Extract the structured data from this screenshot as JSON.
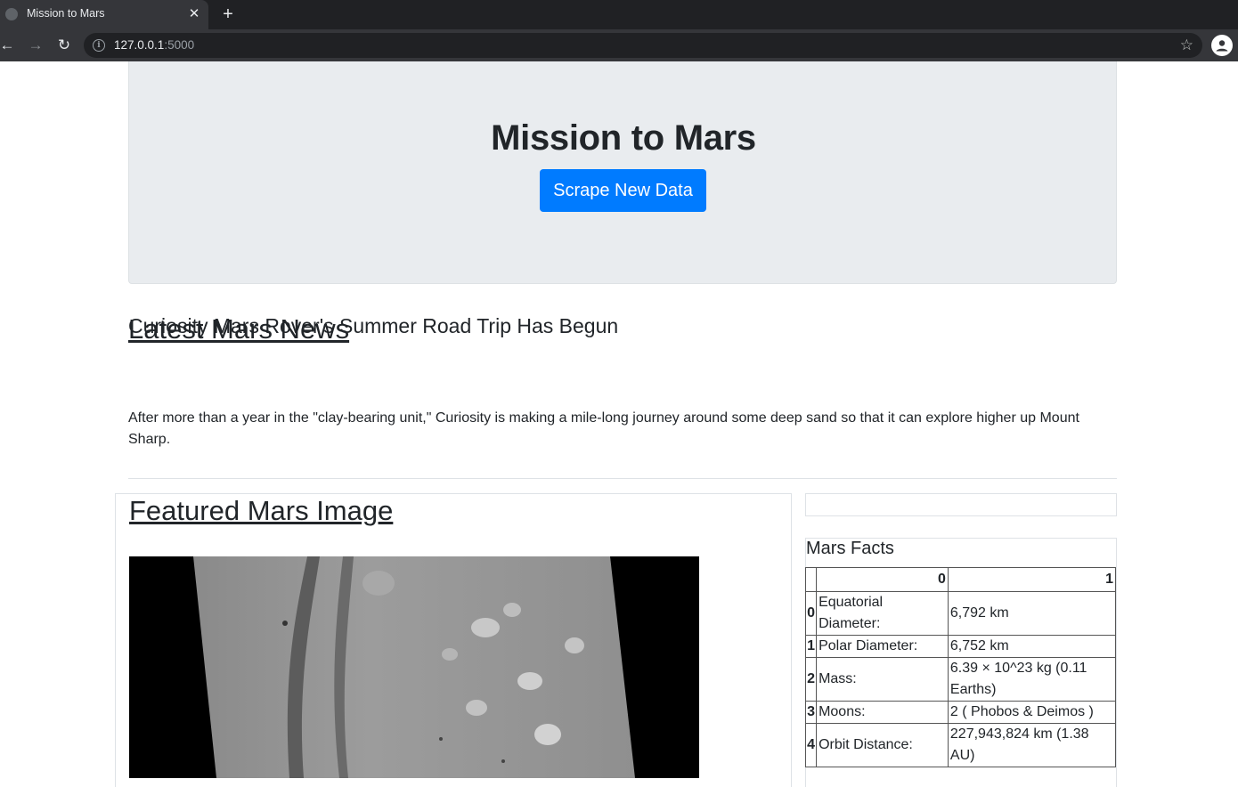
{
  "browser": {
    "tab_title": "Mission to Mars",
    "url_host": "127.0.0.1",
    "url_port": ":5000"
  },
  "hero": {
    "title": "Mission to Mars",
    "button_label": "Scrape New Data"
  },
  "news": {
    "heading": "Latest Mars News",
    "title": "Curiosity Mars Rover's Summer Road Trip Has Begun",
    "paragraph": "After more than a year in the \"clay-bearing unit,\" Curiosity is making a mile-long journey around some deep sand so that it can explore higher up Mount Sharp."
  },
  "featured": {
    "heading": "Featured Mars Image"
  },
  "facts": {
    "title": "Mars Facts",
    "col_headers": [
      "",
      "0",
      "1"
    ],
    "rows": [
      {
        "idx": "0",
        "key": "Equatorial Diameter:",
        "value": "6,792 km"
      },
      {
        "idx": "1",
        "key": "Polar Diameter:",
        "value": "6,752 km"
      },
      {
        "idx": "2",
        "key": "Mass:",
        "value": "6.39 × 10^23 kg (0.11 Earths)"
      },
      {
        "idx": "3",
        "key": "Moons:",
        "value": "2 ( Phobos & Deimos )"
      },
      {
        "idx": "4",
        "key": "Orbit Distance:",
        "value": "227,943,824 km (1.38 AU)"
      }
    ]
  }
}
